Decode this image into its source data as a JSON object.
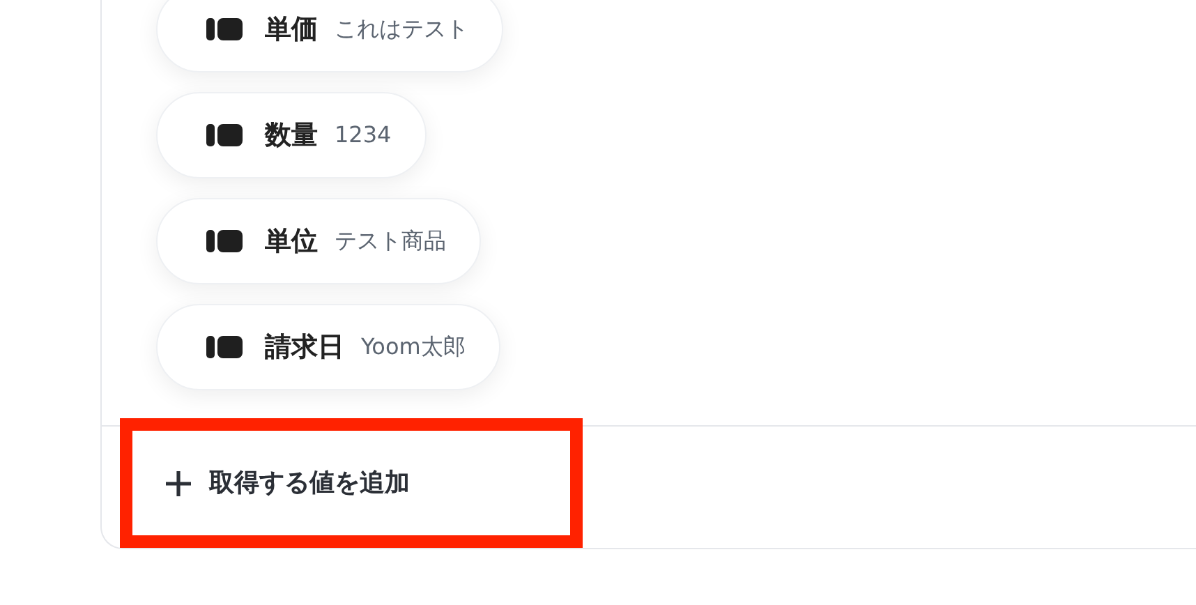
{
  "fields": [
    {
      "label": "単価",
      "value": "これはテスト"
    },
    {
      "label": "数量",
      "value": "1234"
    },
    {
      "label": "単位",
      "value": "テスト商品"
    },
    {
      "label": "請求日",
      "value": "Yoom太郎"
    }
  ],
  "add_button": {
    "label": "取得する値を追加",
    "highlighted": true
  }
}
